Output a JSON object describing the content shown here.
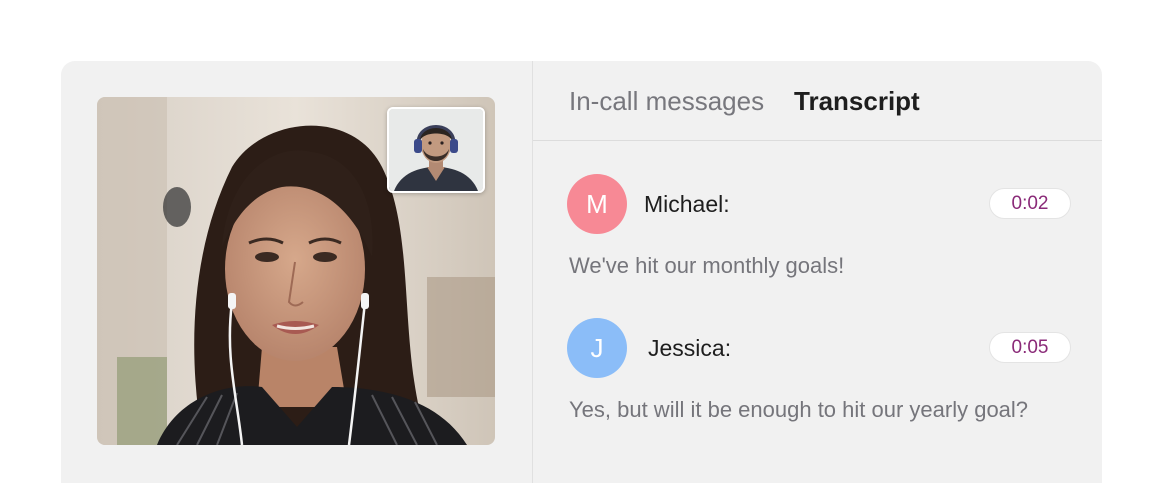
{
  "tabs": {
    "in_call_messages": "In-call messages",
    "transcript": "Transcript"
  },
  "transcript": [
    {
      "initial": "M",
      "speaker": "Michael:",
      "time": "0:02",
      "message": "We've hit our monthly goals!",
      "avatar_color": "#f78995"
    },
    {
      "initial": "J",
      "speaker": "Jessica:",
      "time": "0:05",
      "message": "Yes, but will it be enough to hit our yearly goal?",
      "avatar_color": "#8bbdf8"
    }
  ],
  "colors": {
    "panel_bg": "#f1f1f1",
    "time_text": "#8a2a78",
    "active_tab": "#1e1e1e",
    "inactive_tab": "#77777d"
  }
}
